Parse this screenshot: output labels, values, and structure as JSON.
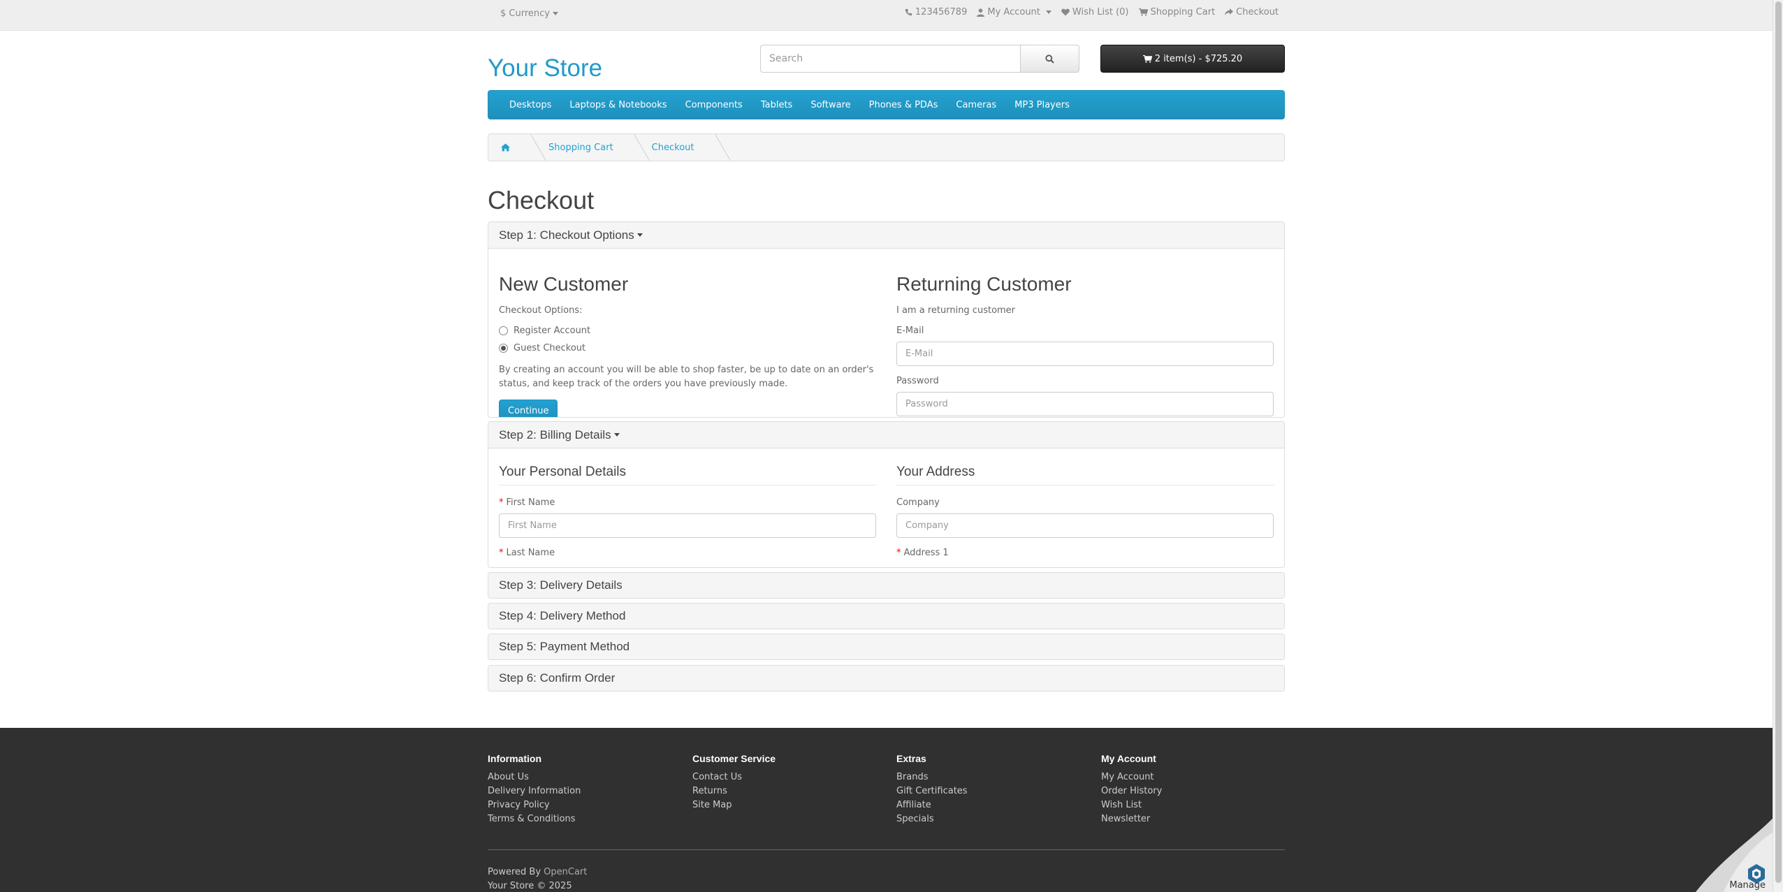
{
  "topbar": {
    "currency": "Currency",
    "currency_symbol": "$",
    "phone": "123456789",
    "my_account": "My Account",
    "wish_list": "Wish List (0)",
    "shopping_cart": "Shopping Cart",
    "checkout": "Checkout"
  },
  "header": {
    "logo": "Your Store",
    "search_placeholder": "Search",
    "cart_button": "2 item(s) - $725.20"
  },
  "menu": [
    "Desktops",
    "Laptops & Notebooks",
    "Components",
    "Tablets",
    "Software",
    "Phones & PDAs",
    "Cameras",
    "MP3 Players"
  ],
  "breadcrumb": [
    "Shopping Cart",
    "Checkout"
  ],
  "page_title": "Checkout",
  "step1": {
    "title": "Step 1: Checkout Options",
    "new_customer": {
      "heading": "New Customer",
      "options_label": "Checkout Options:",
      "register": "Register Account",
      "guest": "Guest Checkout",
      "selected": "Guest Checkout",
      "description": "By creating an account you will be able to shop faster, be up to date on an order's status, and keep track of the orders you have previously made.",
      "continue": "Continue"
    },
    "returning_customer": {
      "heading": "Returning Customer",
      "subtitle": "I am a returning customer",
      "email_label": "E-Mail",
      "email_placeholder": "E-Mail",
      "password_label": "Password",
      "password_placeholder": "Password"
    }
  },
  "step2": {
    "title": "Step 2: Billing Details",
    "personal": {
      "legend": "Your Personal Details",
      "first_name_label": "First Name",
      "first_name_placeholder": "First Name",
      "last_name_label": "Last Name"
    },
    "address": {
      "legend": "Your Address",
      "company_label": "Company",
      "company_placeholder": "Company",
      "address1_label": "Address 1"
    }
  },
  "steps_collapsed": [
    "Step 3: Delivery Details",
    "Step 4: Delivery Method",
    "Step 5: Payment Method",
    "Step 6: Confirm Order"
  ],
  "footer": {
    "information": {
      "title": "Information",
      "links": [
        "About Us",
        "Delivery Information",
        "Privacy Policy",
        "Terms & Conditions"
      ]
    },
    "customer_service": {
      "title": "Customer Service",
      "links": [
        "Contact Us",
        "Returns",
        "Site Map"
      ]
    },
    "extras": {
      "title": "Extras",
      "links": [
        "Brands",
        "Gift Certificates",
        "Affiliate",
        "Specials"
      ]
    },
    "my_account": {
      "title": "My Account",
      "links": [
        "My Account",
        "Order History",
        "Wish List",
        "Newsletter"
      ]
    },
    "powered_by": "Powered By",
    "opencart": "OpenCart",
    "copyright": "Your Store © 2025"
  },
  "manage_label": "Manage",
  "colors": {
    "brand": "#229ac8",
    "menu": "#23a1d1",
    "footer_bg": "#303030",
    "cart_button": "#303030"
  }
}
